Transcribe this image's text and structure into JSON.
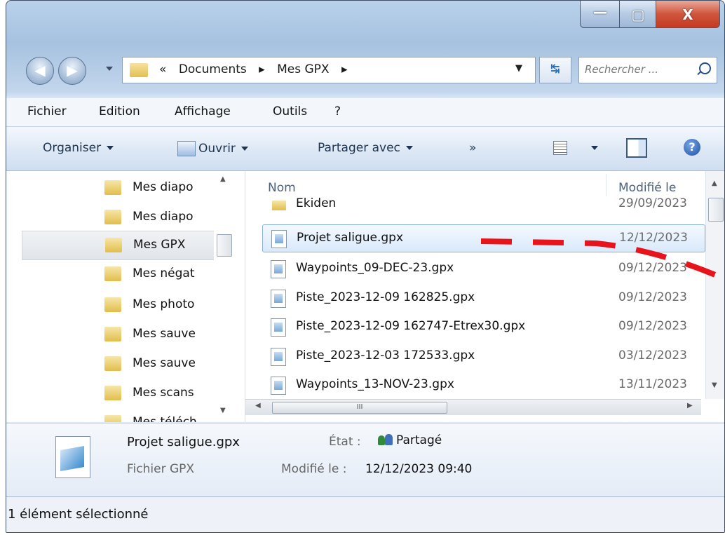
{
  "window": {
    "controls": {
      "minimize": "—",
      "maximize": "▢",
      "close": "X"
    }
  },
  "nav": {
    "back": "◀",
    "forward": "▶",
    "breadcrumb": [
      "«",
      "Documents",
      "▸",
      "Mes GPX",
      "▸"
    ],
    "search_placeholder": "Rechercher ..."
  },
  "menu": [
    "Fichier",
    "Edition",
    "Affichage",
    "Outils",
    "?"
  ],
  "toolbar": {
    "organize": "Organiser",
    "open": "Ouvrir",
    "share": "Partager avec",
    "more": "»"
  },
  "sidebar": {
    "items": [
      {
        "label": "Mes diapo"
      },
      {
        "label": "Mes diapo"
      },
      {
        "label": "Mes GPX"
      },
      {
        "label": "Mes négat"
      },
      {
        "label": "Mes photo"
      },
      {
        "label": "Mes sauve"
      },
      {
        "label": "Mes sauve"
      },
      {
        "label": "Mes scans"
      },
      {
        "label": "Mes téléch"
      }
    ],
    "selected_index": 2
  },
  "files": {
    "columns": {
      "name": "Nom",
      "modified": "Modifié le"
    },
    "rows": [
      {
        "name": "Ekiden",
        "date": "29/09/2023",
        "type": "folder"
      },
      {
        "name": "Projet saligue.gpx",
        "date": "12/12/2023",
        "type": "file"
      },
      {
        "name": "Waypoints_09-DEC-23.gpx",
        "date": "09/12/2023",
        "type": "file"
      },
      {
        "name": "Piste_2023-12-09 162825.gpx",
        "date": "09/12/2023",
        "type": "file"
      },
      {
        "name": "Piste_2023-12-09 162747-Etrex30.gpx",
        "date": "09/12/2023",
        "type": "file"
      },
      {
        "name": "Piste_2023-12-03 172533.gpx",
        "date": "03/12/2023",
        "type": "file"
      },
      {
        "name": "Waypoints_13-NOV-23.gpx",
        "date": "13/11/2023",
        "type": "file"
      }
    ],
    "selected_index": 1,
    "hscroll_grip": "III"
  },
  "details": {
    "name": "Projet saligue.gpx",
    "type": "Fichier GPX",
    "state_label": "État :",
    "state_value": "Partagé",
    "modified_label": "Modifié le :",
    "modified_value": "12/12/2023 09:40"
  },
  "status": {
    "text": "1 élément sélectionné"
  },
  "colors": {
    "annotation": "#e8141c",
    "selection_border": "#88b0e4"
  }
}
